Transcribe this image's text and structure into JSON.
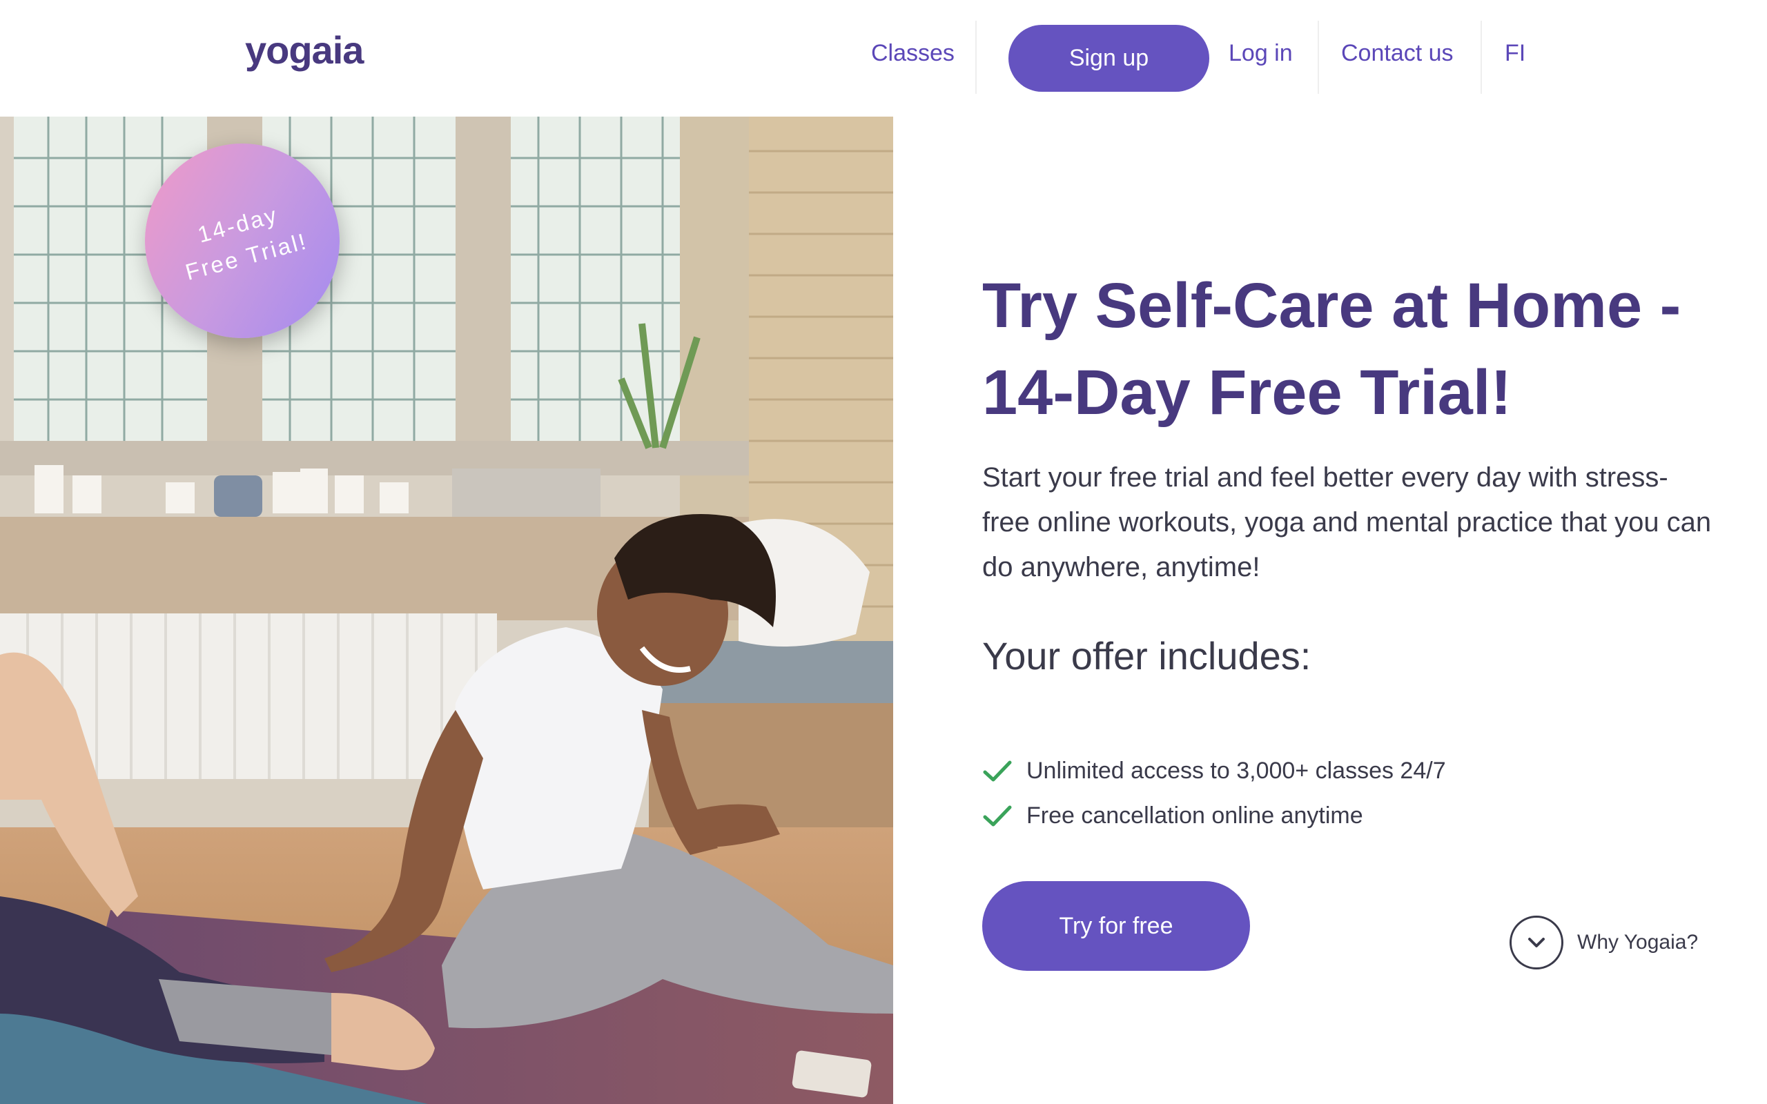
{
  "header": {
    "logo": "yogaia",
    "nav": {
      "classes": "Classes",
      "signup": "Sign up",
      "login": "Log in",
      "contact": "Contact us",
      "language": "FI"
    }
  },
  "badge": {
    "line1": "14-day",
    "line2": "Free Trial!"
  },
  "hero": {
    "title_line1": "Try Self-Care at Home -",
    "title_line2": "14-Day Free Trial!",
    "description": "Start your free trial and feel better every day with stress-free online workouts, yoga and mental practice that you can do anywhere, anytime!",
    "offer_heading": "Your offer includes:",
    "offers": [
      "Unlimited access to 3,000+ classes 24/7",
      "Free cancellation online anytime"
    ],
    "cta": "Try for free",
    "why": "Why Yogaia?"
  },
  "colors": {
    "brand": "#48397f",
    "accent": "#6553c0",
    "check": "#3aa35a",
    "text": "#3a3a4a"
  },
  "icons": {
    "check": "check-icon",
    "chevron": "chevron-down-icon"
  }
}
